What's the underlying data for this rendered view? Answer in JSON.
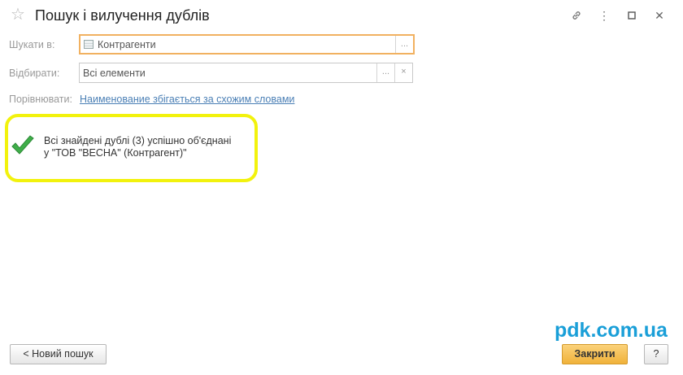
{
  "window": {
    "title": "Пошук і вилучення дублів"
  },
  "form": {
    "search_in": {
      "label": "Шукати в:",
      "value": "Контрагенти",
      "select_button": "..."
    },
    "filter": {
      "label": "Відбирати:",
      "value": "Всі елементи",
      "select_button": "...",
      "clear_button": "×"
    },
    "compare": {
      "label": "Порівнювати:",
      "link": "Наименование збігається за схожим словами"
    }
  },
  "result": {
    "line1": "Всі знайдені дублі (3) успішно об'єднані",
    "line2": "у \"ТОВ \"ВЕСНА\" (Контрагент)\"",
    "highlight_color": "#f2f20d",
    "check_color": "#3fae49"
  },
  "watermark": "pdk.com.ua",
  "footer": {
    "new_search": "< Новий пошук",
    "close": "Закрити",
    "help": "?"
  }
}
